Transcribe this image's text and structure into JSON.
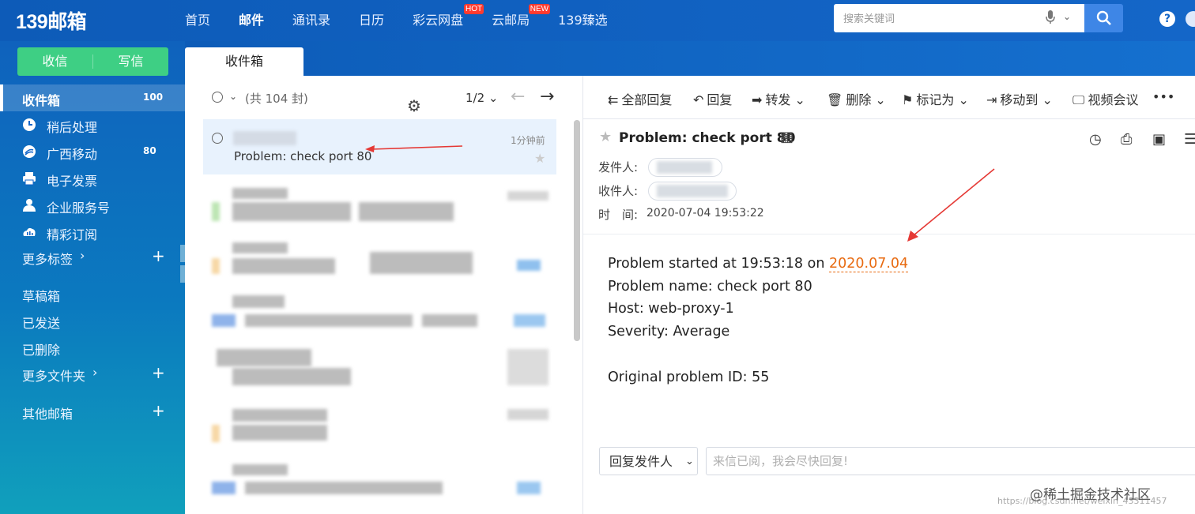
{
  "app": {
    "logo": "139邮箱"
  },
  "nav": {
    "items": [
      {
        "label": "首页",
        "badge": ""
      },
      {
        "label": "邮件",
        "badge": ""
      },
      {
        "label": "通讯录",
        "badge": ""
      },
      {
        "label": "日历",
        "badge": ""
      },
      {
        "label": "彩云网盘",
        "badge": "HOT"
      },
      {
        "label": "云邮局",
        "badge": "NEW"
      },
      {
        "label": "139臻选",
        "badge": ""
      }
    ],
    "active_index": 1
  },
  "search": {
    "placeholder": "搜索关键词"
  },
  "compose": {
    "inbox_label": "收信",
    "write_label": "写信"
  },
  "sidebar": {
    "items": [
      {
        "label": "收件箱",
        "count": "100"
      },
      {
        "label": "稍后处理",
        "count": ""
      },
      {
        "label": "广西移动",
        "count": "80"
      },
      {
        "label": "电子发票",
        "count": ""
      },
      {
        "label": "企业服务号",
        "count": ""
      },
      {
        "label": "精彩订阅",
        "count": ""
      },
      {
        "label": "更多标签",
        "count": ""
      },
      {
        "label": "草稿箱",
        "count": ""
      },
      {
        "label": "已发送",
        "count": ""
      },
      {
        "label": "已删除",
        "count": ""
      },
      {
        "label": "更多文件夹",
        "count": ""
      },
      {
        "label": "其他邮箱",
        "count": ""
      }
    ]
  },
  "tab": {
    "label": "收件箱"
  },
  "list": {
    "total_label": "(共 104 封)",
    "pager": "1/2",
    "selected_mail": {
      "subject": "Problem: check port 80",
      "time": "1分钟前"
    }
  },
  "reader": {
    "toolbar": {
      "reply_all": "全部回复",
      "reply": "回复",
      "forward": "转发",
      "delete": "删除",
      "mark": "标记为",
      "move": "移动到",
      "video": "视频会议",
      "more": "•••"
    },
    "title": "Problem: check port 80",
    "from_label": "发件人:",
    "to_label": "收件人:",
    "time_label": "时　间:",
    "time_value": "2020-07-04 19:53:22",
    "body": {
      "line1_prefix": "Problem started at 19:53:18 on ",
      "line1_date": "2020.07.04",
      "line2": "Problem name: check port 80",
      "line3": "Host: web-proxy-1",
      "line4": "Severity: Average",
      "line5": "Original problem ID: 55"
    },
    "reply_select": "回复发件人",
    "reply_placeholder": "来信已阅，我会尽快回复!"
  },
  "watermark": {
    "main": "@稀土掘金技术社区",
    "sub": "https://blog.csdn.net/weixin_43311457"
  },
  "colors": {
    "brand": "#1466c8",
    "compose": "#3ecf84",
    "link": "#e86a10",
    "arrow": "#e53935"
  }
}
